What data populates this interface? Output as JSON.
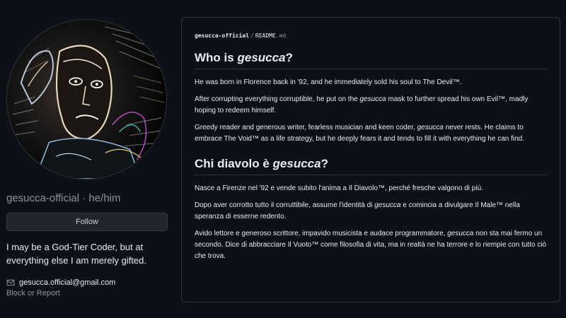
{
  "profile": {
    "username": "gesucca-official",
    "separator": "·",
    "pronouns": "he/him",
    "follow_label": "Follow",
    "bio": "I may be a God-Tier Coder, but at everything else I am merely gifted.",
    "email": "gesucca.official@gmail.com",
    "block_report_label": "Block or Report",
    "icons": {
      "email": "mail-icon",
      "avatar": "avatar-image"
    }
  },
  "readme": {
    "path": {
      "owner": "gesucca-official",
      "separator": "/",
      "file": "README",
      "ext": ".md"
    },
    "en": {
      "heading_prefix": "Who is ",
      "heading_name": "gesucca",
      "heading_suffix": "?",
      "p1": "He was born in Florence back in '92, and he immediately sold his soul to The Devil™.",
      "p2_a": "After corrupting everything corruptible, he put on the ",
      "p2_name": "gesucca",
      "p2_b": " mask to further spread his own Evil™, madly hoping to redeem himself.",
      "p3_a": "Greedy reader and generous writer, fearless musician and keen coder, ",
      "p3_name": "gesucca",
      "p3_b": " never rests. He claims to embrace The Void™ as a life strategy, but he deeply fears it and tends to fill it with everything he can find."
    },
    "it": {
      "heading_prefix": "Chi diavolo è ",
      "heading_name": "gesucca",
      "heading_suffix": "?",
      "p1": "Nasce a Firenze nel '92 e vende subito l'anima a Il Diavolo™, perché fresche valgono di più.",
      "p2_a": "Dopo aver corrotto tutto il corruttibile, assume l'identità di ",
      "p2_name": "gesucca",
      "p2_b": " e comincia a divulgare Il Male™ nella speranza di esserne redento.",
      "p3_a": "Avido lettore e generoso scrittore, impavido musicista e audace programmatore, ",
      "p3_name": "gesucca",
      "p3_b": " non sta mai fermo un secondo. Dice di abbracciare Il Vuoto™ come filosofia di vita, ma in realtà ne ha terrore e lo riempie con tutto ciò che trova."
    }
  },
  "colors": {
    "background": "#0d1117",
    "border": "#30363d",
    "text": "#e6edf3",
    "muted": "#8b949e",
    "button_bg": "#21262d"
  }
}
